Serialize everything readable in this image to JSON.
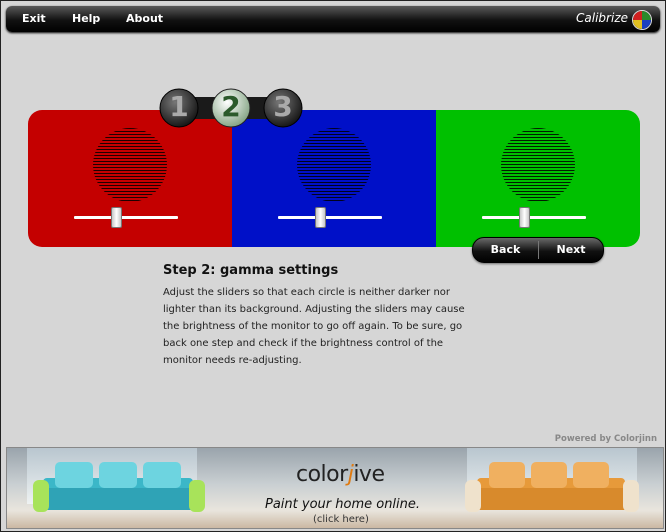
{
  "menu": {
    "items": [
      {
        "label": "Exit"
      },
      {
        "label": "Help"
      },
      {
        "label": "About"
      }
    ],
    "brand": "Calibrize",
    "logo_icon": "color-wheel-icon"
  },
  "steps": {
    "labels": [
      "1",
      "2",
      "3"
    ],
    "current": "2"
  },
  "panels": [
    {
      "name": "red",
      "color": "#c40000",
      "slider_value": 0.4
    },
    {
      "name": "blue",
      "color": "#0010c8",
      "slider_value": 0.4
    },
    {
      "name": "green",
      "color": "#00c000",
      "slider_value": 0.4
    }
  ],
  "nav": {
    "back_label": "Back",
    "next_label": "Next"
  },
  "content": {
    "title": "Step 2: gamma settings",
    "lines": [
      "Adjust the sliders so that each circle is neither darker nor",
      "lighter than its background. Adjusting the sliders may cause",
      "the brightness of the monitor to go off again. To be sure, go",
      "back one step and check if the brightness control of the",
      "monitor needs re-adjusting."
    ]
  },
  "powered_by": "Powered by Colorjinn",
  "banner": {
    "logo_prefix": "color",
    "logo_j": "j",
    "logo_suffix": "ive",
    "tagline": "Paint your home online.",
    "cta": "(click here)"
  }
}
